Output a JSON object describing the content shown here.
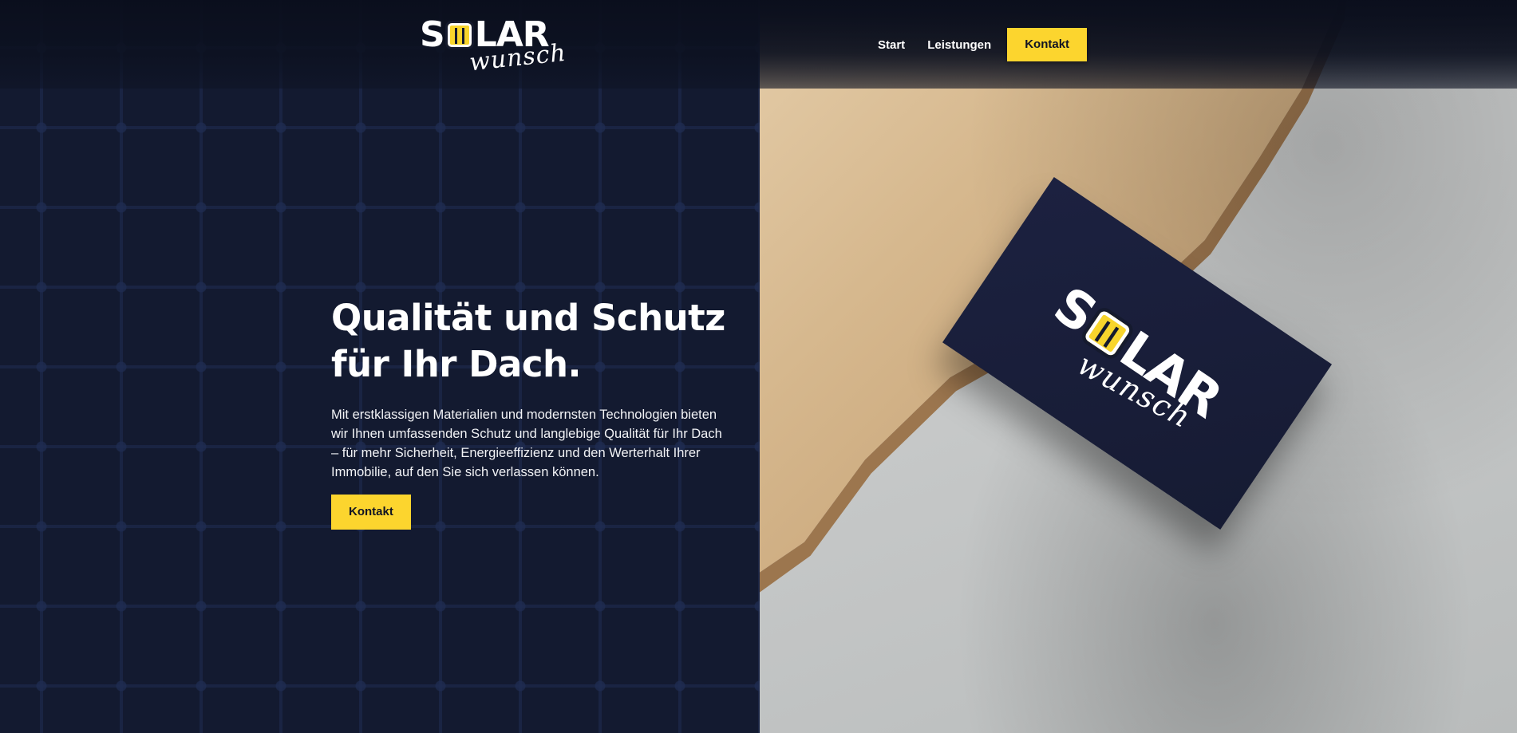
{
  "brand": {
    "logo_word": "S LAR",
    "logo_part_s": "S",
    "logo_part_lar": "LAR",
    "logo_script": "wunsch",
    "accent_color": "#fcd52e",
    "dark_color": "#131a30"
  },
  "nav": {
    "items": [
      {
        "label": "Start"
      },
      {
        "label": "Leistungen"
      }
    ],
    "cta_label": "Kontakt"
  },
  "hero": {
    "title_line1": "Qualität und Schutz",
    "title_line2": "für Ihr Dach.",
    "text": "Mit erstklassigen Materialien und modernsten Technologien bieten wir Ihnen umfassenden Schutz und langlebige Qualität für Ihr Dach – für mehr Sicherheit, Energieeffizienz und den Werterhalt Ihrer Immobilie, auf den Sie sich verlassen können.",
    "button_label": "Kontakt"
  }
}
